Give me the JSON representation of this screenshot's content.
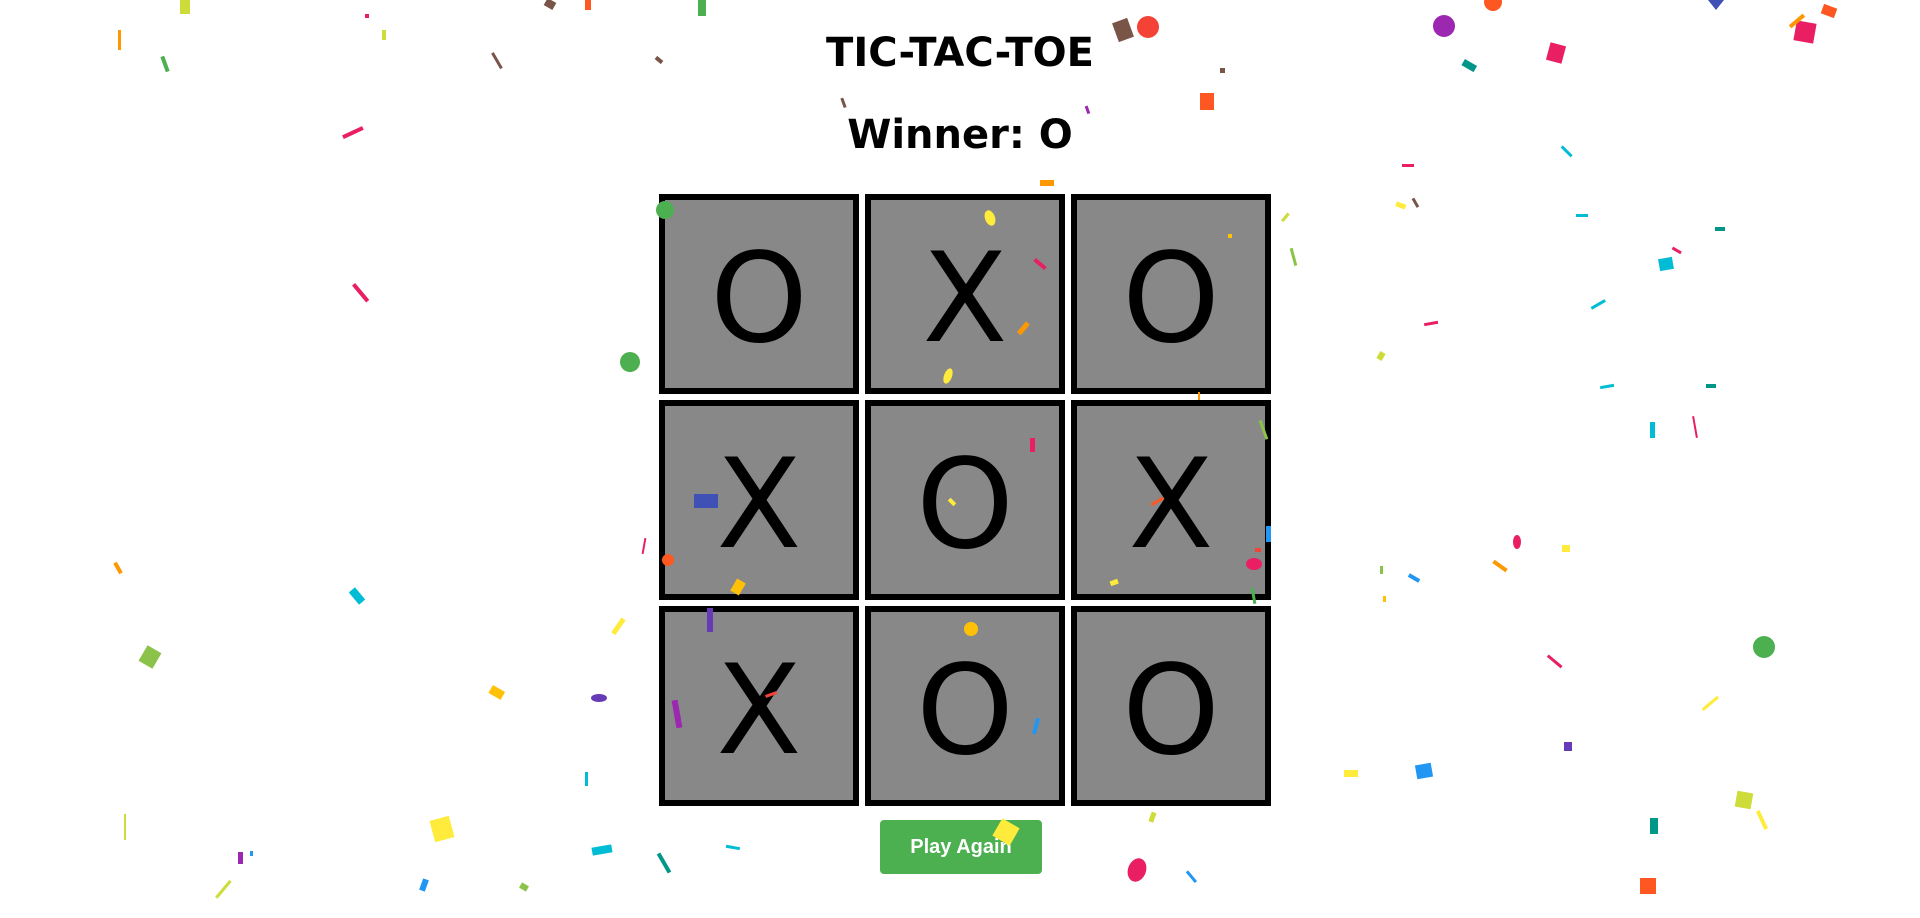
{
  "game": {
    "title": "TIC-TAC-TOE",
    "status": "Winner: O",
    "board": [
      "O",
      "X",
      "O",
      "X",
      "O",
      "X",
      "X",
      "O",
      "O"
    ],
    "play_again_label": "Play Again"
  },
  "colors": {
    "cell_background": "#888888",
    "cell_border": "#000000",
    "button_background": "#4caf50",
    "button_text": "#ffffff"
  }
}
